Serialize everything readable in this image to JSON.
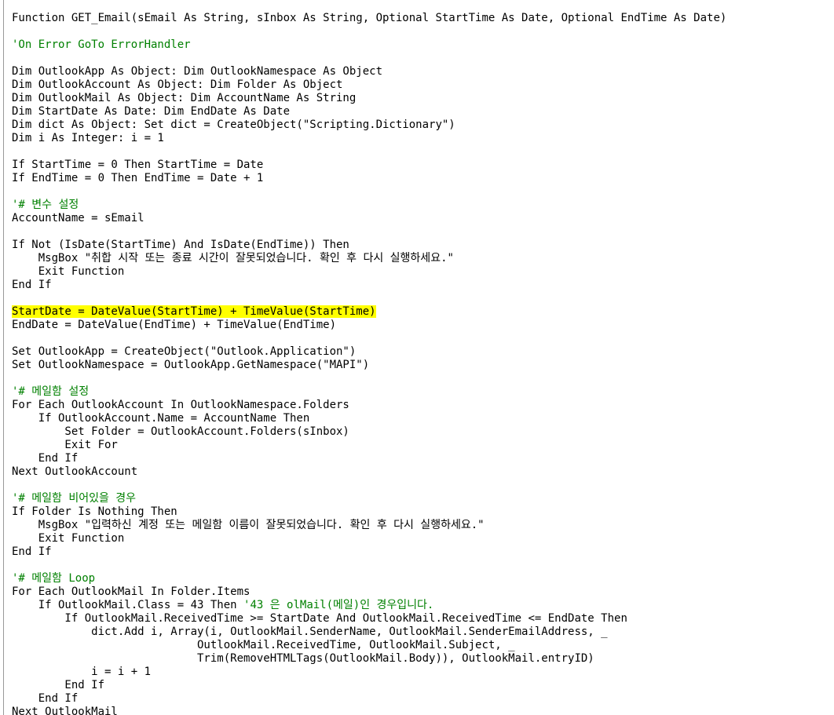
{
  "editor": {
    "highlight_color": "#ffff00",
    "comment_color": "#008000",
    "lines": [
      {
        "code": "Function GET_Email(sEmail As String, sInbox As String, Optional StartTime As Date, Optional EndTime As Date)",
        "comment": ""
      },
      {
        "code": "",
        "comment": ""
      },
      {
        "code": "",
        "comment": "'On Error GoTo ErrorHandler"
      },
      {
        "code": "",
        "comment": ""
      },
      {
        "code": "Dim OutlookApp As Object: Dim OutlookNamespace As Object",
        "comment": ""
      },
      {
        "code": "Dim OutlookAccount As Object: Dim Folder As Object",
        "comment": ""
      },
      {
        "code": "Dim OutlookMail As Object: Dim AccountName As String",
        "comment": ""
      },
      {
        "code": "Dim StartDate As Date: Dim EndDate As Date",
        "comment": ""
      },
      {
        "code": "Dim dict As Object: Set dict = CreateObject(\"Scripting.Dictionary\")",
        "comment": ""
      },
      {
        "code": "Dim i As Integer: i = 1",
        "comment": ""
      },
      {
        "code": "",
        "comment": ""
      },
      {
        "code": "If StartTime = 0 Then StartTime = Date",
        "comment": ""
      },
      {
        "code": "If EndTime = 0 Then EndTime = Date + 1",
        "comment": ""
      },
      {
        "code": "",
        "comment": ""
      },
      {
        "code": "",
        "comment": "'# 변수 설정"
      },
      {
        "code": "AccountName = sEmail",
        "comment": ""
      },
      {
        "code": "",
        "comment": ""
      },
      {
        "code": "If Not (IsDate(StartTime) And IsDate(EndTime)) Then",
        "comment": ""
      },
      {
        "code": "    MsgBox \"취합 시작 또는 종료 시간이 잘못되었습니다. 확인 후 다시 실행하세요.\"",
        "comment": ""
      },
      {
        "code": "    Exit Function",
        "comment": ""
      },
      {
        "code": "End If",
        "comment": ""
      },
      {
        "code": "",
        "comment": ""
      },
      {
        "code": "StartDate = DateValue(StartTime) + TimeValue(StartTime)",
        "comment": "",
        "highlight": true
      },
      {
        "code": "EndDate = DateValue(EndTime) + TimeValue(EndTime)",
        "comment": ""
      },
      {
        "code": "",
        "comment": ""
      },
      {
        "code": "Set OutlookApp = CreateObject(\"Outlook.Application\")",
        "comment": ""
      },
      {
        "code": "Set OutlookNamespace = OutlookApp.GetNamespace(\"MAPI\")",
        "comment": ""
      },
      {
        "code": "",
        "comment": ""
      },
      {
        "code": "",
        "comment": "'# 메일함 설정"
      },
      {
        "code": "For Each OutlookAccount In OutlookNamespace.Folders",
        "comment": ""
      },
      {
        "code": "    If OutlookAccount.Name = AccountName Then",
        "comment": ""
      },
      {
        "code": "        Set Folder = OutlookAccount.Folders(sInbox)",
        "comment": ""
      },
      {
        "code": "        Exit For",
        "comment": ""
      },
      {
        "code": "    End If",
        "comment": ""
      },
      {
        "code": "Next OutlookAccount",
        "comment": ""
      },
      {
        "code": "",
        "comment": ""
      },
      {
        "code": "",
        "comment": "'# 메일함 비어있을 경우"
      },
      {
        "code": "If Folder Is Nothing Then",
        "comment": ""
      },
      {
        "code": "    MsgBox \"입력하신 계정 또는 메일함 이름이 잘못되었습니다. 확인 후 다시 실행하세요.\"",
        "comment": ""
      },
      {
        "code": "    Exit Function",
        "comment": ""
      },
      {
        "code": "End If",
        "comment": ""
      },
      {
        "code": "",
        "comment": ""
      },
      {
        "code": "",
        "comment": "'# 메일함 Loop"
      },
      {
        "code": "For Each OutlookMail In Folder.Items",
        "comment": ""
      },
      {
        "code": "    If OutlookMail.Class = 43 Then ",
        "comment": "'43 은 olMail(메일)인 경우입니다."
      },
      {
        "code": "        If OutlookMail.ReceivedTime >= StartDate And OutlookMail.ReceivedTime <= EndDate Then",
        "comment": ""
      },
      {
        "code": "            dict.Add i, Array(i, OutlookMail.SenderName, OutlookMail.SenderEmailAddress, _",
        "comment": ""
      },
      {
        "code": "                            OutlookMail.ReceivedTime, OutlookMail.Subject, _",
        "comment": ""
      },
      {
        "code": "                            Trim(RemoveHTMLTags(OutlookMail.Body)), OutlookMail.entryID)",
        "comment": ""
      },
      {
        "code": "            i = i + 1",
        "comment": ""
      },
      {
        "code": "        End If",
        "comment": ""
      },
      {
        "code": "    End If",
        "comment": ""
      },
      {
        "code": "Next OutlookMail",
        "comment": ""
      }
    ]
  }
}
